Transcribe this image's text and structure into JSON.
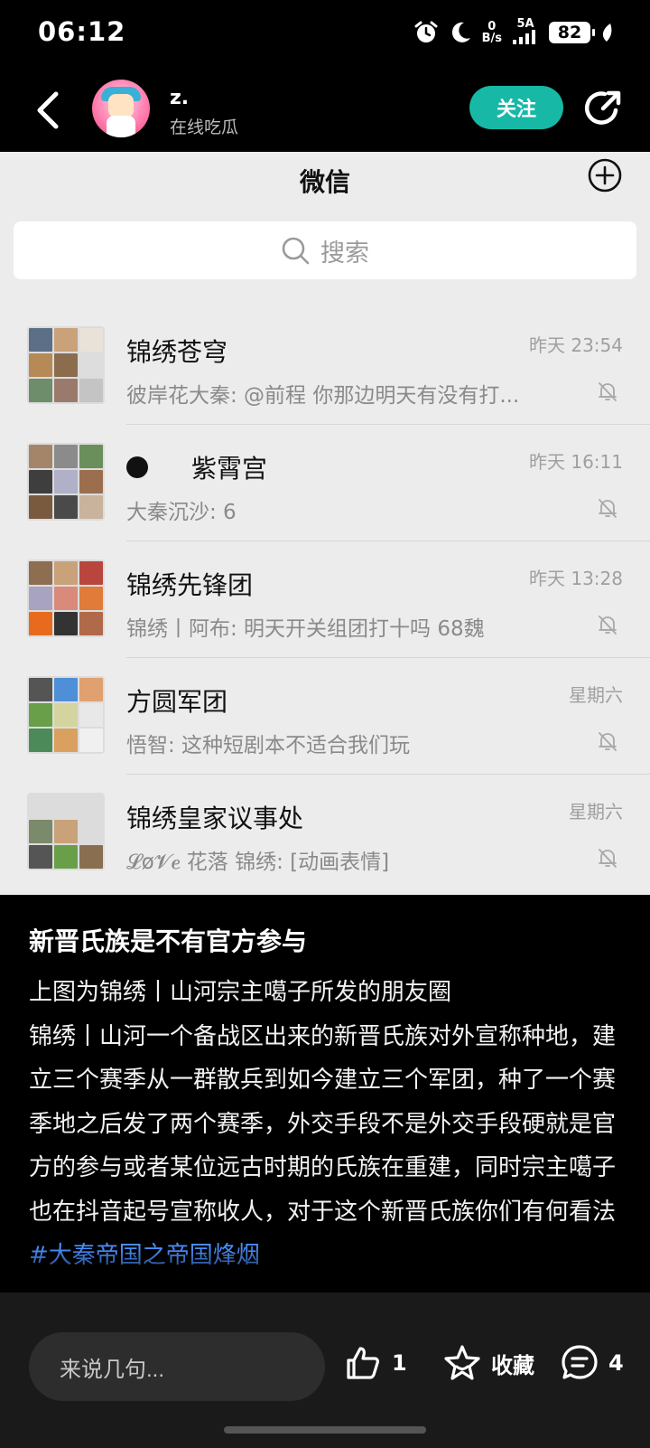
{
  "status_bar": {
    "time": "06:12",
    "net_speed_value": "0",
    "net_speed_unit": "B/s",
    "network": "5A",
    "battery": "82"
  },
  "header": {
    "user_name": "z.",
    "user_status": "在线吃瓜",
    "follow_label": "关注"
  },
  "screenshot": {
    "title": "微信",
    "search_placeholder": "搜索",
    "chats": [
      {
        "name": "锦绣苍穹",
        "preview": "彼岸花大秦: @前程 你那边明天有没有打...",
        "time": "昨天 23:54",
        "has_dot": false
      },
      {
        "name": "紫霄宫",
        "preview": "大秦沉沙: 6",
        "time": "昨天 16:11",
        "has_dot": true
      },
      {
        "name": "锦绣先锋团",
        "preview": "锦绣丨阿布: 明天开关组团打十吗  68魏",
        "time": "昨天 13:28",
        "has_dot": false
      },
      {
        "name": "方圆军团",
        "preview": "悟智: 这种短剧本不适合我们玩",
        "time": "星期六",
        "has_dot": false
      },
      {
        "name": "锦绣皇家议事处",
        "preview": "𝓛ø𝓥𝒆 花落 锦绣: [动画表情]",
        "time": "星期六",
        "has_dot": false
      }
    ]
  },
  "article": {
    "title": "新晋氏族是不有官方参与",
    "body": "上图为锦绣丨山河宗主噶子所发的朋友圈\n锦绣丨山河一个备战区出来的新晋氏族对外宣称种地，建立三个赛季从一群散兵到如今建立三个军团，种了一个赛季地之后发了两个赛季，外交手段不是外交手段硬就是官方的参与或者某位远古时期的氏族在重建，同时宗主噶子也在抖音起号宣称收人，对于这个新晋氏族你们有何看法 ",
    "hashtag": "#大秦帝国之帝国烽烟"
  },
  "bottom_bar": {
    "comment_placeholder": "来说几句...",
    "like_count": "1",
    "favorite_label": "收藏",
    "comment_count": "4"
  },
  "icons": {
    "back": "chevron-left-icon",
    "share": "share-icon",
    "plus": "plus-circle-icon",
    "search": "search-icon",
    "mute": "bell-off-icon",
    "like": "thumbs-up-icon",
    "favorite": "star-icon",
    "comment": "comment-icon"
  },
  "colors": {
    "follow_button": "#17b8a6",
    "hashtag": "#4a90ff",
    "background": "#000000",
    "screenshot_background": "#ececec"
  }
}
